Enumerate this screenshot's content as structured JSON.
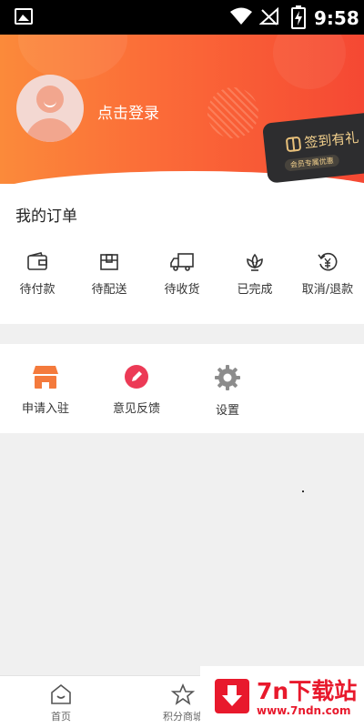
{
  "status_bar": {
    "time": "9:58",
    "icons": [
      "image-icon",
      "wifi-icon",
      "no-signal-icon",
      "battery-charging-icon"
    ]
  },
  "header": {
    "login_text": "点击登录",
    "signin_card": {
      "title": "签到有礼",
      "subtitle": "会员专属优惠"
    }
  },
  "orders": {
    "title": "我的订单",
    "items": [
      {
        "label": "待付款",
        "icon": "wallet-icon"
      },
      {
        "label": "待配送",
        "icon": "package-icon"
      },
      {
        "label": "待收货",
        "icon": "truck-icon"
      },
      {
        "label": "已完成",
        "icon": "lotus-icon"
      },
      {
        "label": "取消/退款",
        "icon": "refund-icon"
      }
    ]
  },
  "services": {
    "items": [
      {
        "label": "申请入驻",
        "icon": "store-icon"
      },
      {
        "label": "意见反馈",
        "icon": "edit-icon"
      },
      {
        "label": "设置",
        "icon": "gear-icon"
      }
    ]
  },
  "tabbar": {
    "items": [
      {
        "label": "首页",
        "icon": "home-icon"
      },
      {
        "label": "积分商城",
        "icon": "star-icon"
      }
    ]
  },
  "watermark": {
    "brand": "7n下载站",
    "url": "www.7ndn.com"
  },
  "colors": {
    "header_start": "#fb8a3a",
    "header_end": "#f54833",
    "store_icon": "#f47a3c",
    "edit_icon": "#ec3a56",
    "gear_icon": "#8c8c8c",
    "watermark_red": "#e8192c",
    "card_gold": "#f1cf8c"
  }
}
